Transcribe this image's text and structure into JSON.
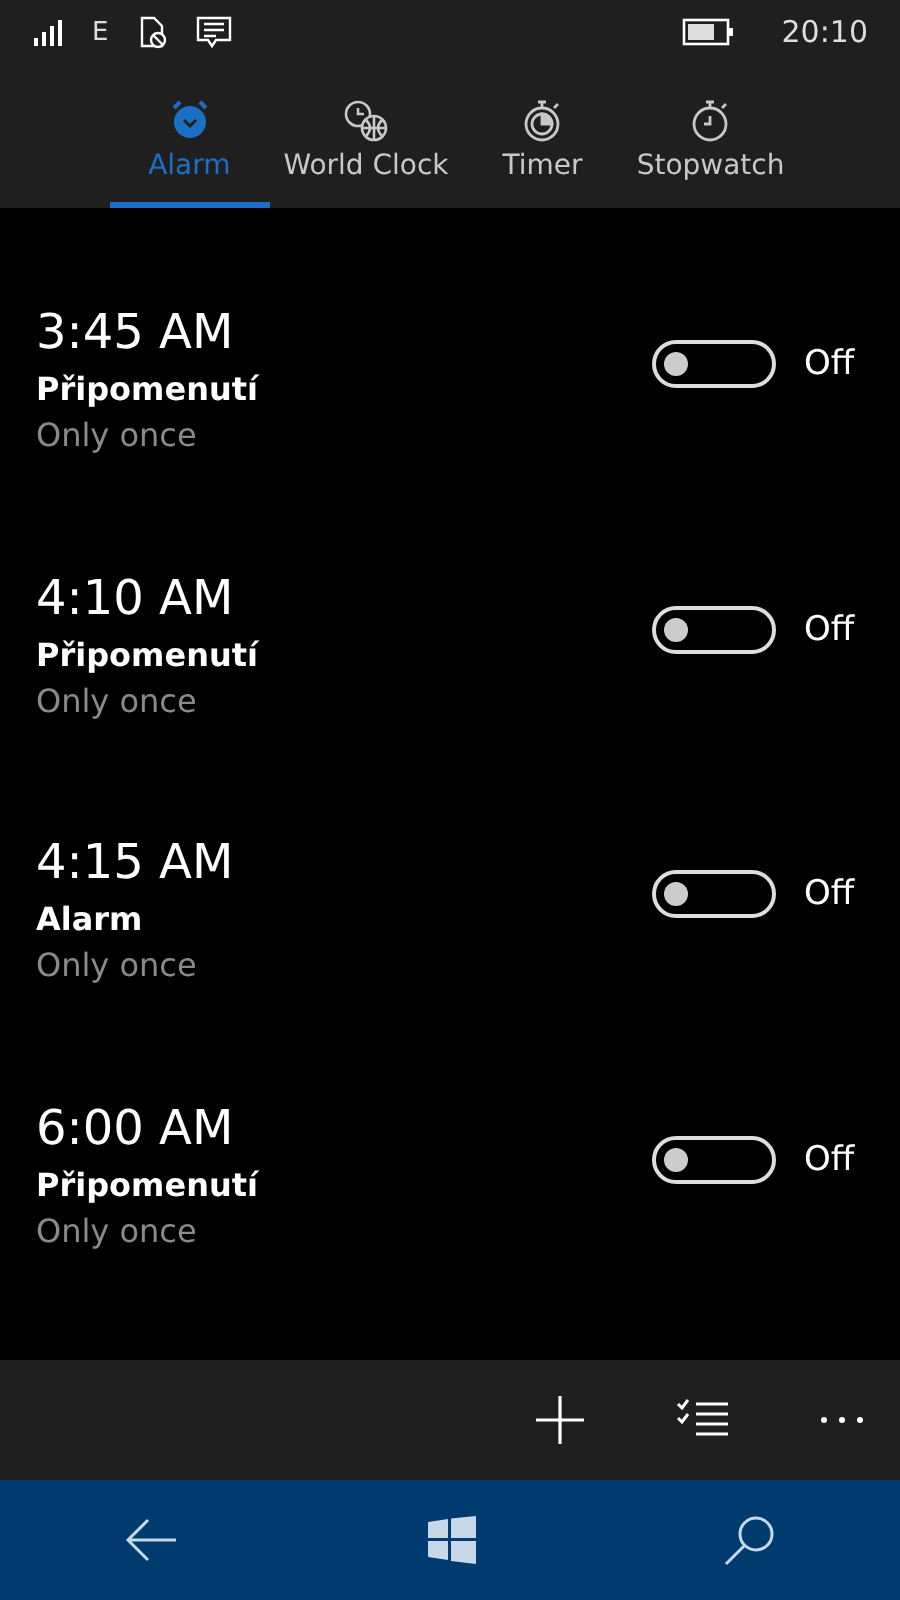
{
  "status_bar": {
    "network": "E",
    "time": "20:10"
  },
  "tabs": [
    {
      "label": "Alarm",
      "kind": "alarm",
      "selected": true
    },
    {
      "label": "World Clock",
      "kind": "world",
      "selected": false
    },
    {
      "label": "Timer",
      "kind": "timer",
      "selected": false
    },
    {
      "label": "Stopwatch",
      "kind": "stopwatch",
      "selected": false
    }
  ],
  "alarms": [
    {
      "time": "3:45 AM",
      "name": "Připomenutí",
      "repeat": "Only once",
      "on": false,
      "state": "Off"
    },
    {
      "time": "4:10 AM",
      "name": "Připomenutí",
      "repeat": "Only once",
      "on": false,
      "state": "Off"
    },
    {
      "time": "4:15 AM",
      "name": "Alarm",
      "repeat": "Only once",
      "on": false,
      "state": "Off"
    },
    {
      "time": "6:00 AM",
      "name": "Připomenutí",
      "repeat": "Only once",
      "on": false,
      "state": "Off"
    }
  ]
}
